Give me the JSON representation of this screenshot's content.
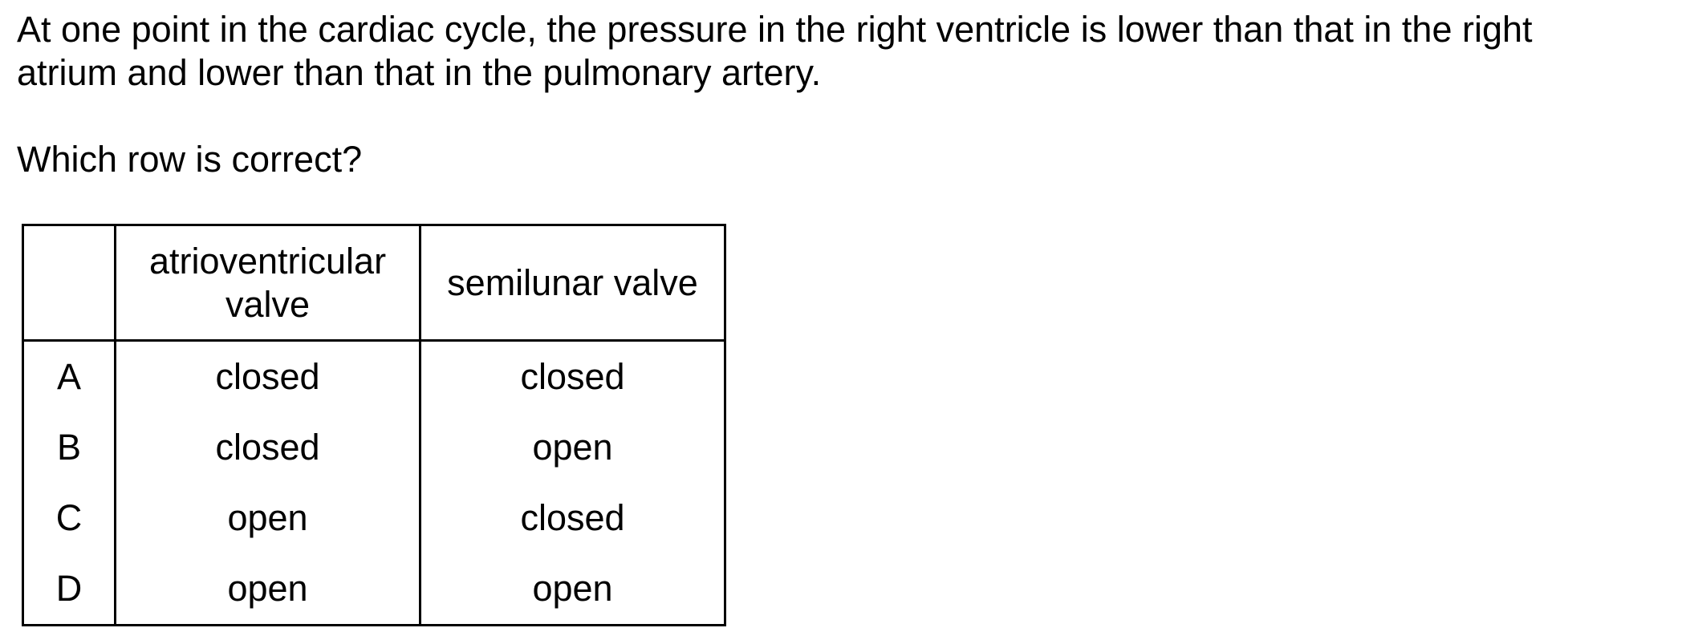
{
  "question": {
    "stem_line1": "At one point in the cardiac cycle, the pressure in the right ventricle is lower than that in the right",
    "stem_line2": "atrium and lower than that in the pulmonary artery.",
    "prompt": "Which row is correct?"
  },
  "table": {
    "headers": {
      "key": "",
      "av_line1": "atrioventricular",
      "av_line2": "valve",
      "semilunar": "semilunar valve"
    },
    "rows": [
      {
        "key": "A",
        "atrioventricular": "closed",
        "semilunar": "closed"
      },
      {
        "key": "B",
        "atrioventricular": "closed",
        "semilunar": "open"
      },
      {
        "key": "C",
        "atrioventricular": "open",
        "semilunar": "closed"
      },
      {
        "key": "D",
        "atrioventricular": "open",
        "semilunar": "open"
      }
    ]
  }
}
